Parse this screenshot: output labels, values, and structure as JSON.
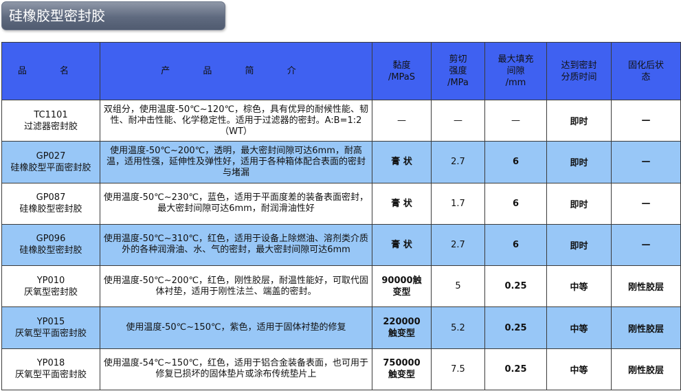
{
  "title": "硅橡胶型密封胶",
  "headers": {
    "name": "品 名",
    "intro": "产 品 简 介",
    "viscosity": [
      "黏度",
      "/MPaS"
    ],
    "shear": [
      "剪切",
      "强度",
      "/MPa"
    ],
    "gap": [
      "最大填充",
      "间隙",
      "/mm"
    ],
    "cure_time": [
      "达到密封",
      "分质时间"
    ],
    "cured_state": [
      "固化后状",
      "态"
    ]
  },
  "rows": [
    {
      "code": "TC1101",
      "name": "过滤器密封胶",
      "desc": "双组分，使用温度-50℃~120℃，棕色，具有优异的耐候性能、韧性、耐冲击性能、化学稳定性。适用于过滤器的密封。A:B=1:2（WT）",
      "viscosity": [
        "—"
      ],
      "shear": "—",
      "gap": "—",
      "time": "即时",
      "state": "—"
    },
    {
      "code": "GP027",
      "name": "硅橡胶型平面密封胶",
      "desc": "使用温度-50℃~200℃，透明，最大密封间隙可达6mm，耐高温，适用性强，延伸性及弹性好，适用于各种箱体配合表面的密封与堵漏",
      "viscosity": [
        "膏 状"
      ],
      "shear": "2.7",
      "gap": "6",
      "time": "即时",
      "state": "—"
    },
    {
      "code": "GP087",
      "name": "硅橡胶型密封胶",
      "desc": "使用温度-50℃~230℃，蓝色，适用于平面度差的装备表面密封，最大密封间隙可达6mm，耐润滑油性好",
      "viscosity": [
        "膏 状"
      ],
      "shear": "1.7",
      "gap": "6",
      "time": "即时",
      "state": "—"
    },
    {
      "code": "GP096",
      "name": "硅橡胶型密封胶",
      "desc": "使用温度-50℃~310℃，红色，适用于设备上除燃油、溶剂类介质外的各种润滑油、水、气的密封，最大密封间隙可达6mm",
      "viscosity": [
        "膏 状"
      ],
      "shear": "2.7",
      "gap": "6",
      "time": "即时",
      "state": "—"
    },
    {
      "code": "YP010",
      "name": "厌氧型密封胶",
      "desc": "使用温度-50℃~200℃，红色，刚性胶层，耐温性能好，可取代固体衬垫，适用于刚性法兰、端盖的密封。",
      "viscosity": [
        "90000触",
        "变型"
      ],
      "shear": "5",
      "gap": "0.25",
      "time": "中等",
      "state": "刚性胶层"
    },
    {
      "code": "YP015",
      "name": "厌氧型平面密封胶",
      "desc": "使用温度-50℃~150℃，紫色，适用于固体衬垫的修复",
      "viscosity": [
        "220000",
        "触变型"
      ],
      "shear": "5.2",
      "gap": "0.25",
      "time": "中等",
      "state": "刚性胶层"
    },
    {
      "code": "YP018",
      "name": "厌氧型平面密封胶",
      "desc": "使用温度-54℃~150℃，红色，适用于铝合金装备表面，也可用于修复已损坏的固体垫片或涂布传统垫片上",
      "viscosity": [
        "750000",
        "触变型"
      ],
      "shear": "7.5",
      "gap": "0.25",
      "time": "中等",
      "state": "刚性胶层"
    }
  ]
}
